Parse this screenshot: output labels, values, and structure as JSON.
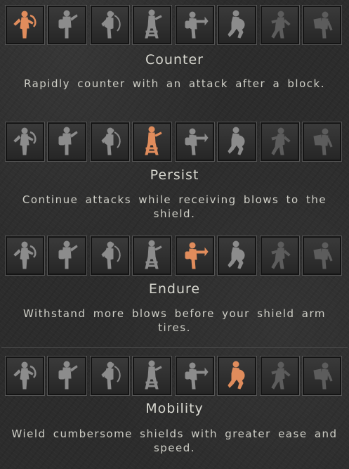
{
  "colors": {
    "active_icon": "#e08c5c",
    "inactive_icon": "#8c8c8c",
    "dim_icon": "#5c5c5c"
  },
  "icons": [
    "counter-icon",
    "persist-icon",
    "endure-icon",
    "ladder-icon",
    "blow-icon",
    "mobility-icon",
    "retreat-icon",
    "trip-icon"
  ],
  "sections": [
    {
      "title": "Counter",
      "description": "Rapidly counter with an attack after a block.",
      "selected_index": 0
    },
    {
      "title": "Persist",
      "description": "Continue attacks while receiving blows to the shield.",
      "selected_index": 3
    },
    {
      "title": "Endure",
      "description": "Withstand more blows before your shield arm tires.",
      "selected_index": 4
    },
    {
      "title": "Mobility",
      "description": "Wield cumbersome shields with greater ease and speed.",
      "selected_index": 5
    }
  ]
}
